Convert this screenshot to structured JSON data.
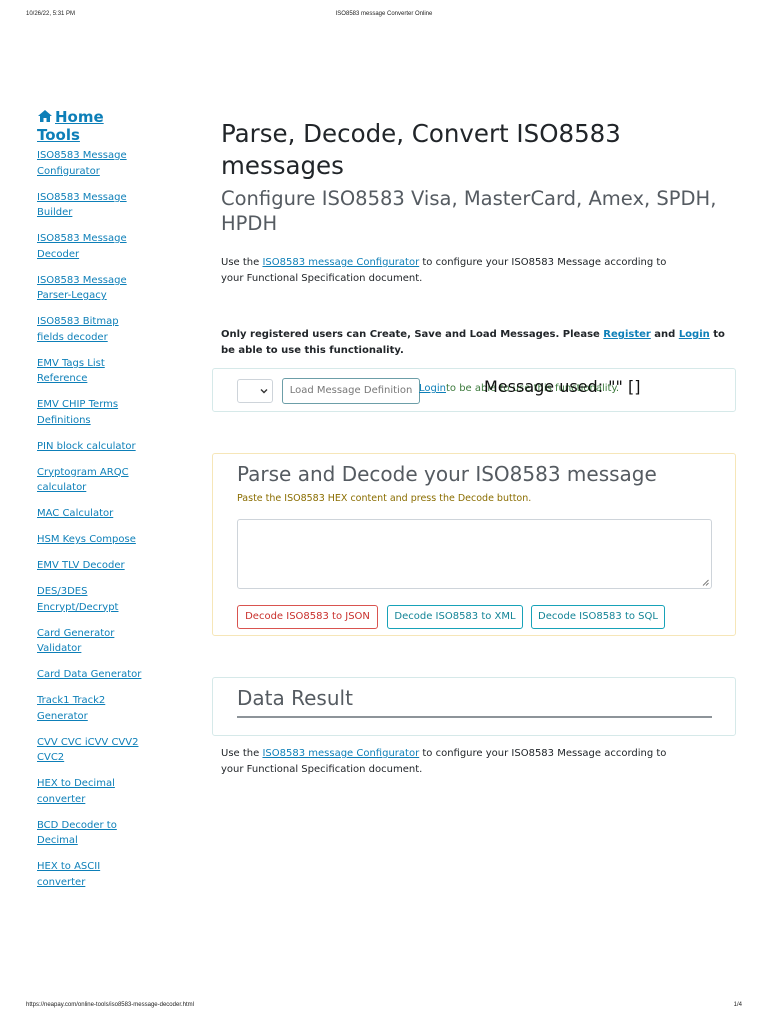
{
  "print": {
    "date": "10/26/22, 5:31 PM",
    "title": "ISO8583 message Converter Online",
    "url": "https://neapay.com/online-tools/iso8583-message-decoder.html",
    "page": "1/4"
  },
  "sidebar": {
    "home_label": "Home Tools",
    "links": [
      "ISO8583 Message Configurator",
      "ISO8583 Message Builder",
      "ISO8583 Message Decoder",
      "ISO8583 Message Parser-Legacy",
      "ISO8583 Bitmap fields decoder",
      "EMV Tags List Reference",
      "EMV CHIP Terms Definitions",
      "PIN block calculator",
      "Cryptogram ARQC calculator",
      "MAC Calculator",
      "HSM Keys Compose",
      "EMV TLV Decoder",
      "DES/3DES Encrypt/Decrypt",
      "Card Generator Validator",
      "Card Data Generator",
      "Track1 Track2 Generator",
      "CVV CVC iCVV CVV2 CVC2",
      "HEX to Decimal converter",
      "BCD Decoder to Decimal",
      "HEX to ASCII converter"
    ]
  },
  "main": {
    "title": "Parse, Decode, Convert ISO8583 messages",
    "subtitle": "Configure ISO8583 Visa, MasterCard, Amex, SPDH, HPDH",
    "intro": {
      "prefix": "Use the ",
      "link": "ISO8583 message Configurator",
      "suffix": " to configure your ISO8583 Message according to your Functional Specification document."
    },
    "notice": {
      "prefix": "Only registered users can Create, Save and Load Messages. Please ",
      "register": "Register",
      "and": " and ",
      "login": "Login",
      "suffix": " to be able to use this functionality."
    }
  },
  "loader": {
    "select_value": "",
    "load_button": "Load Message Definition",
    "login_link": "Login",
    "login_suffix": "to be able to use this functionality.",
    "message_used": "Message used: \"\" []"
  },
  "decoder": {
    "title": "Parse and Decode your ISO8583 message",
    "hint": "Paste the ISO8583 HEX content and press the Decode button.",
    "hex_value": "",
    "buttons": {
      "json": "Decode ISO8583 to JSON",
      "xml": "Decode ISO8583 to XML",
      "sql": "Decode ISO8583 to SQL"
    }
  },
  "result": {
    "title": "Data Result"
  },
  "footer_note": {
    "prefix": "Use the ",
    "link": "ISO8583 message Configurator",
    "suffix": " to configure your ISO8583 Message according to your Functional Specification document."
  },
  "colors": {
    "link": "#0d7fb8",
    "danger": "#d9534f",
    "info": "#17a2b8",
    "warning_text": "#8a6d00"
  },
  "icons": {
    "home": "home-icon",
    "select": "chevron-down-icon",
    "textarea": "resize-handle-icon"
  }
}
